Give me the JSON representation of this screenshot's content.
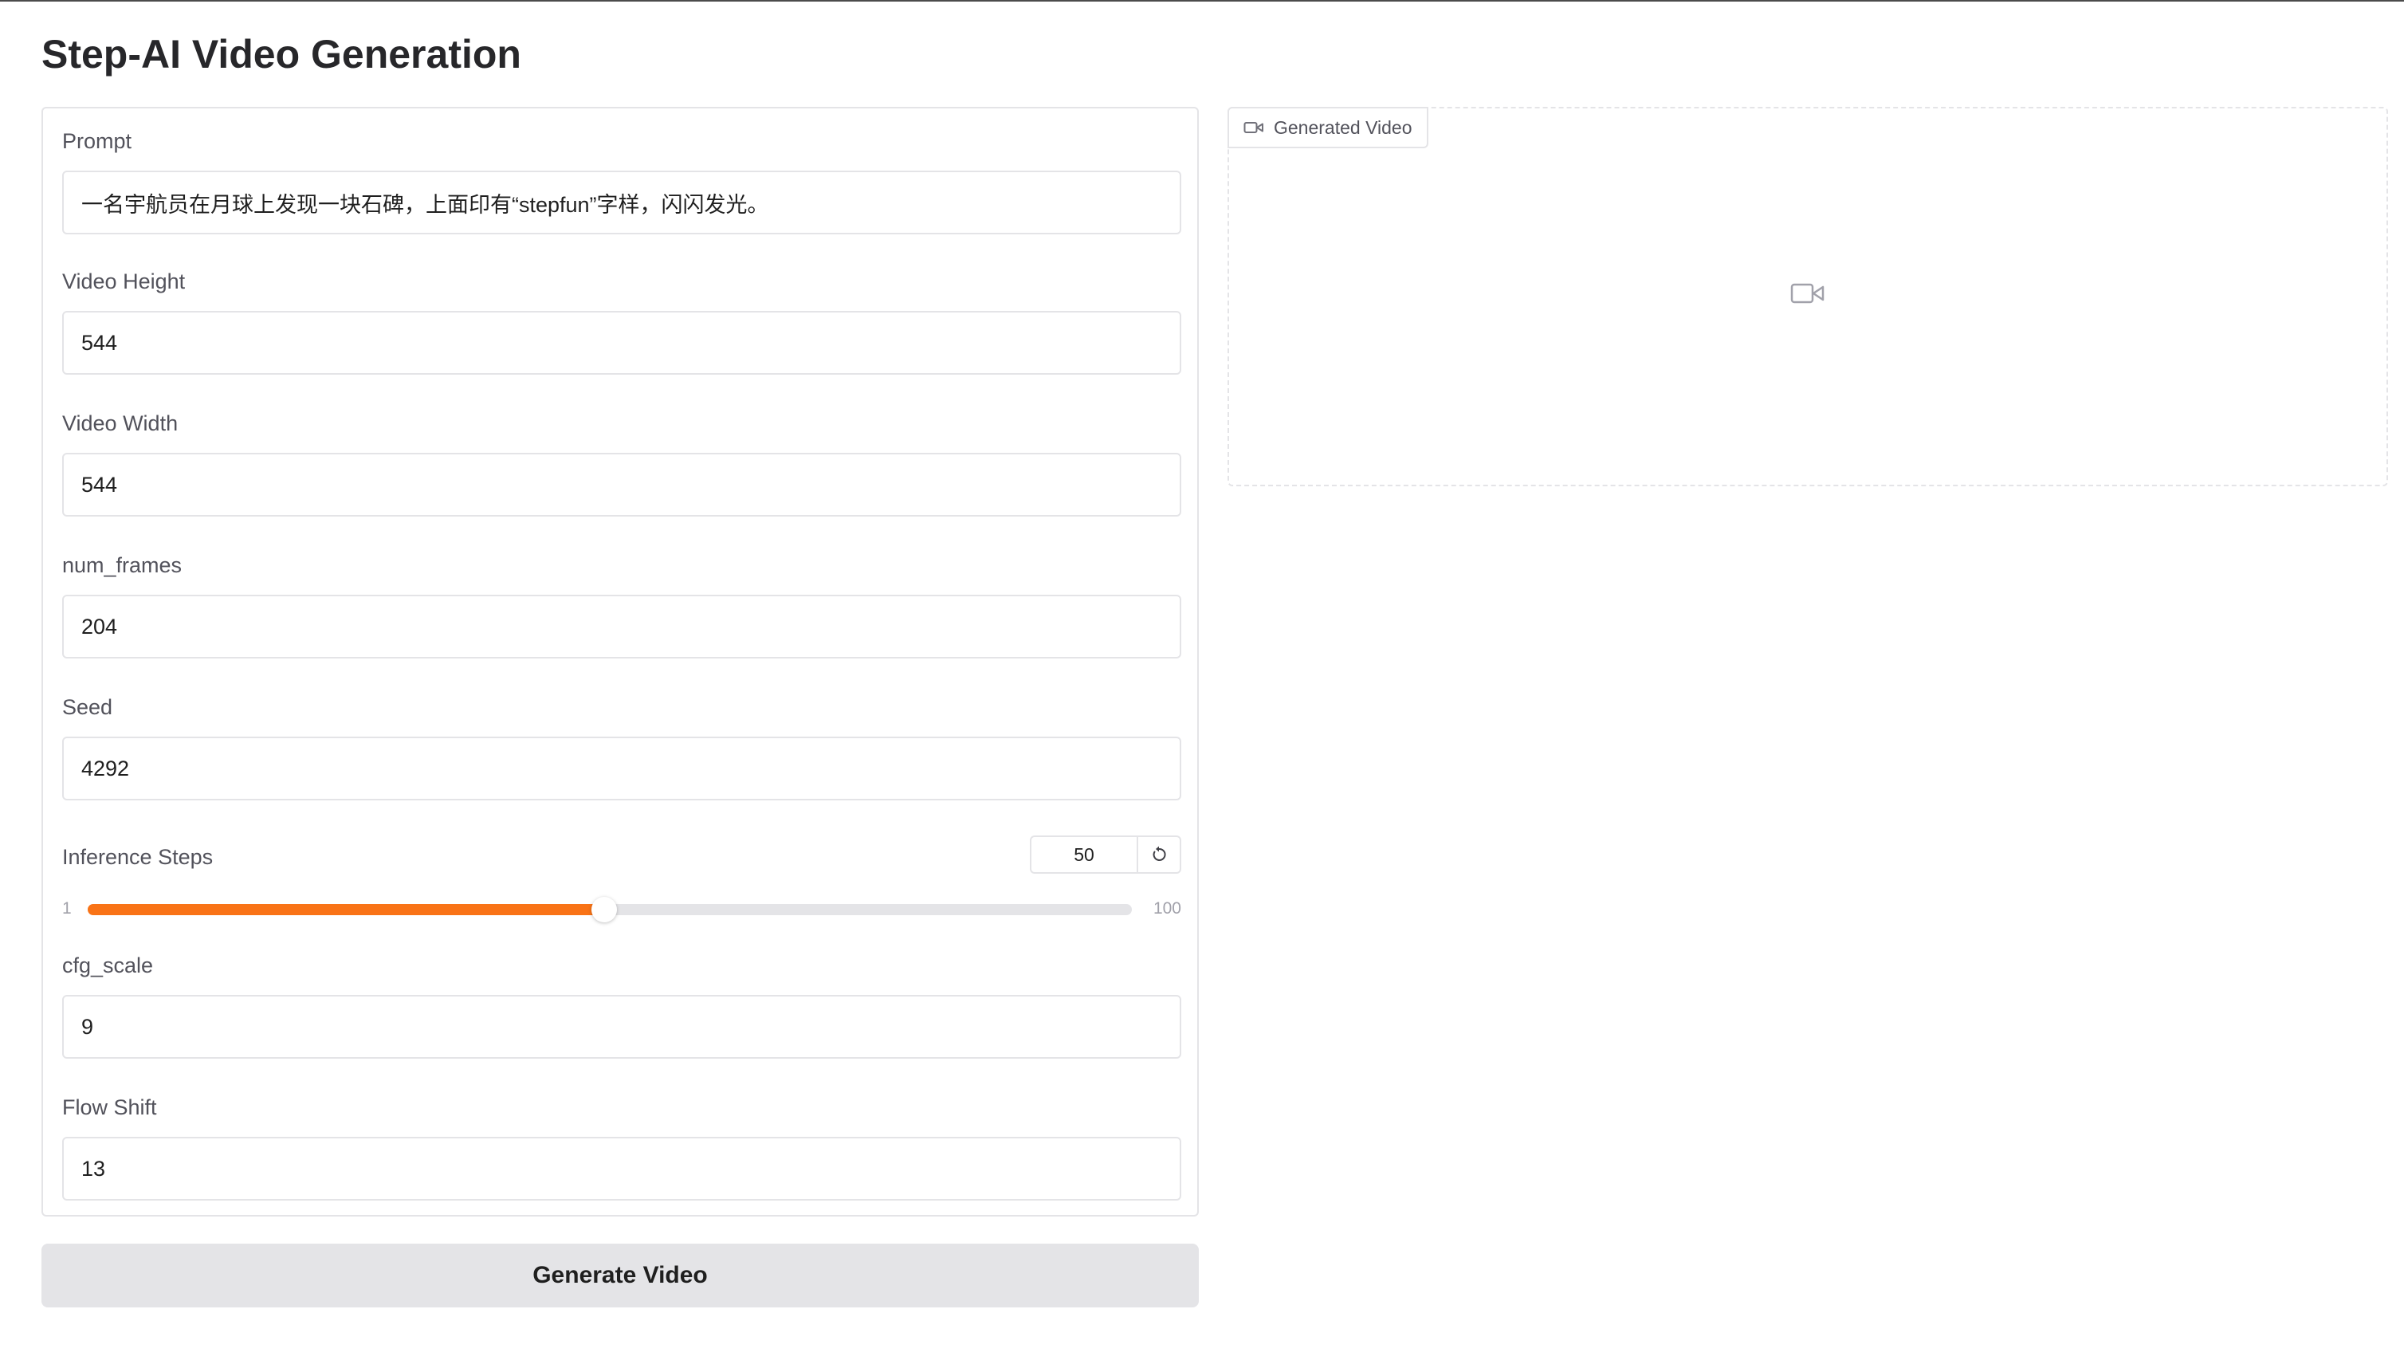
{
  "page": {
    "title": "Step-AI Video Generation"
  },
  "form": {
    "prompt": {
      "label": "Prompt",
      "value": "一名宇航员在月球上发现一块石碑，上面印有“stepfun”字样，闪闪发光。"
    },
    "video_height": {
      "label": "Video Height",
      "value": "544"
    },
    "video_width": {
      "label": "Video Width",
      "value": "544"
    },
    "num_frames": {
      "label": "num_frames",
      "value": "204"
    },
    "seed": {
      "label": "Seed",
      "value": "4292"
    },
    "inference_steps": {
      "label": "Inference Steps",
      "value": "50",
      "min": "1",
      "max": "100",
      "reset_icon": "reset-icon"
    },
    "cfg_scale": {
      "label": "cfg_scale",
      "value": "9"
    },
    "flow_shift": {
      "label": "Flow Shift",
      "value": "13"
    }
  },
  "actions": {
    "generate_label": "Generate Video"
  },
  "output": {
    "tab_label": "Generated Video",
    "tab_icon": "video-camera-icon",
    "placeholder_icon": "video-camera-icon"
  },
  "colors": {
    "accent": "#f97316",
    "border": "#e4e4e7",
    "button_bg": "#e4e4e7"
  }
}
